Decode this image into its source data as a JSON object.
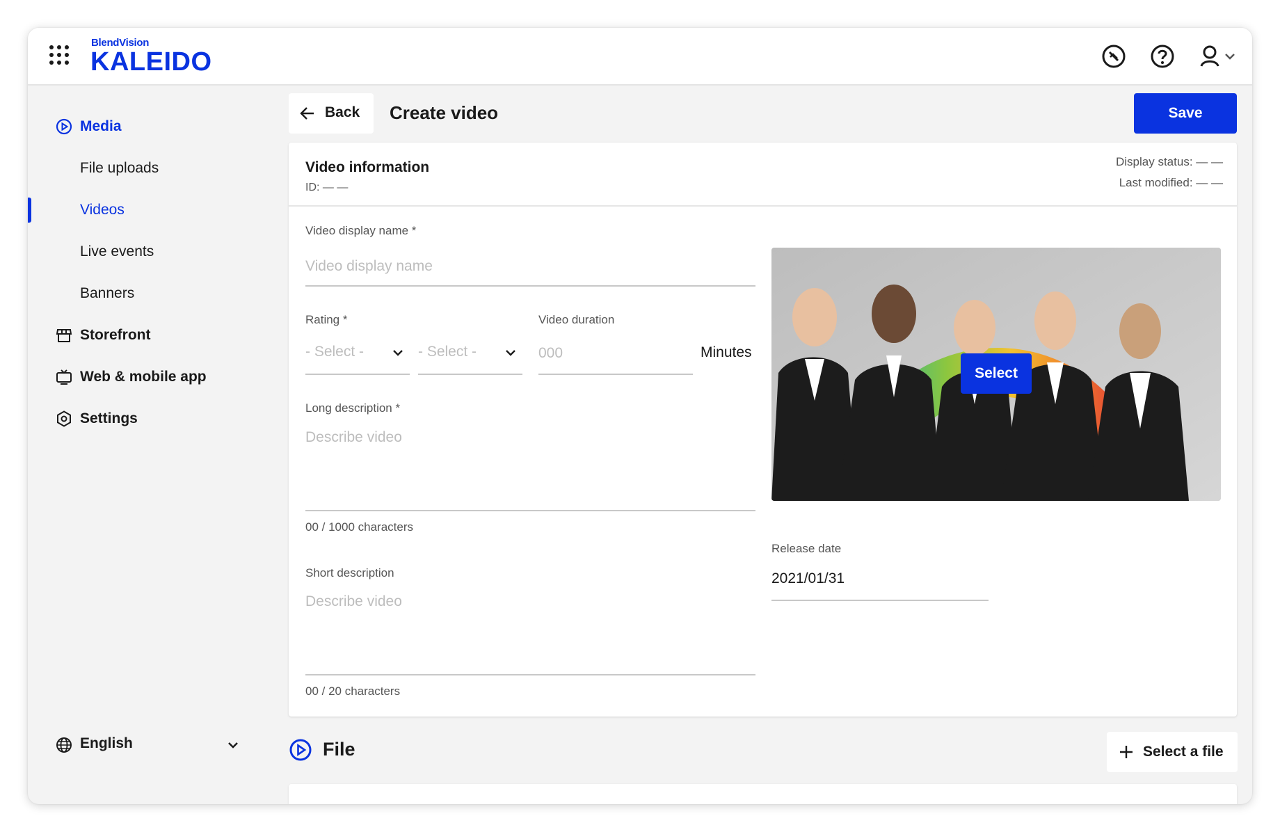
{
  "brand": {
    "small": "BlendVision",
    "big": "KALEIDO"
  },
  "header_icons": [
    "apps-grid-icon",
    "no-sign-icon",
    "help-icon",
    "user-icon",
    "chevron-down-icon"
  ],
  "sidebar": {
    "items": [
      {
        "label": "Media",
        "icon": "play-circle-icon",
        "bold": true,
        "active": true
      },
      {
        "label": "File uploads"
      },
      {
        "label": "Videos",
        "selected": true
      },
      {
        "label": "Live events"
      },
      {
        "label": "Banners"
      },
      {
        "label": "Storefront",
        "icon": "storefront-icon",
        "bold": true
      },
      {
        "label": "Web & mobile app",
        "icon": "tv-icon",
        "bold": true
      },
      {
        "label": "Settings",
        "icon": "gear-icon",
        "bold": true
      }
    ],
    "language": "English"
  },
  "page": {
    "back_label": "Back",
    "title": "Create video",
    "save_label": "Save"
  },
  "video_info": {
    "title": "Video information",
    "id_line": "ID: — —",
    "display_status": "Display status: — —",
    "last_modified": "Last modified: — —"
  },
  "form": {
    "display_name": {
      "label": "Video display name *",
      "placeholder": "Video display name"
    },
    "rating": {
      "label": "Rating *",
      "select1": "- Select -",
      "select2": "- Select -"
    },
    "duration": {
      "label": "Video duration",
      "placeholder": "000",
      "unit": "Minutes"
    },
    "long_description": {
      "label": "Long description *",
      "placeholder": "Describe video",
      "counter": "00 / 1000 characters"
    },
    "short_description": {
      "label": "Short description",
      "placeholder": "Describe video",
      "counter": "00 / 20 characters"
    },
    "thumbnail": {
      "select_label": "Select"
    },
    "release_date": {
      "label": "Release date",
      "value": "2021/01/31"
    }
  },
  "file_section": {
    "title": "File",
    "select_file_label": "Select a file"
  },
  "colors": {
    "accent": "#0a33e0",
    "background": "#f3f3f3"
  }
}
